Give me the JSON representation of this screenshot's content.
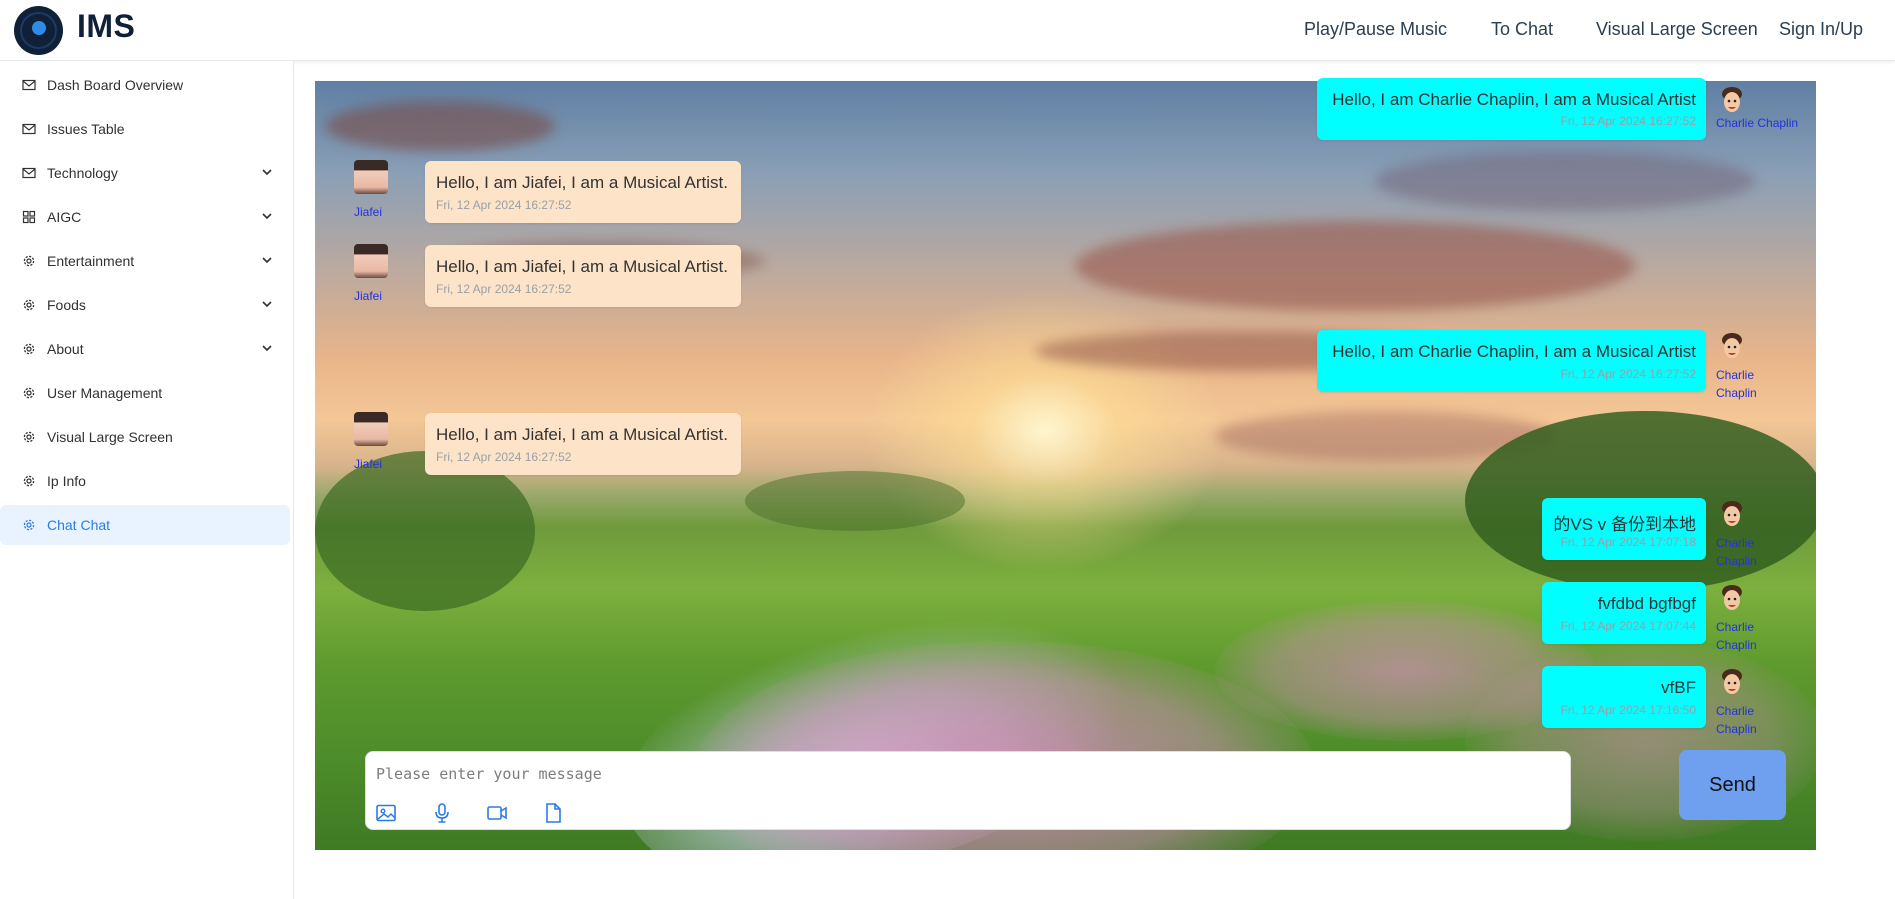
{
  "header": {
    "app_title": "IMS",
    "nav": [
      "Play/Pause Music",
      "To Chat",
      "Visual Large Screen",
      "Sign In/Up"
    ]
  },
  "sidebar": {
    "items": [
      {
        "label": "Dash Board Overview",
        "icon": "mail-icon",
        "expandable": false
      },
      {
        "label": "Issues Table",
        "icon": "mail-icon",
        "expandable": false
      },
      {
        "label": "Technology",
        "icon": "mail-icon",
        "expandable": true
      },
      {
        "label": "AIGC",
        "icon": "grid-icon",
        "expandable": true
      },
      {
        "label": "Entertainment",
        "icon": "gear-icon",
        "expandable": true
      },
      {
        "label": "Foods",
        "icon": "gear-icon",
        "expandable": true
      },
      {
        "label": "About",
        "icon": "gear-icon",
        "expandable": true
      },
      {
        "label": "User Management",
        "icon": "gear-icon",
        "expandable": false
      },
      {
        "label": "Visual Large Screen",
        "icon": "gear-icon",
        "expandable": false
      },
      {
        "label": "Ip Info",
        "icon": "gear-icon",
        "expandable": false
      },
      {
        "label": "Chat Chat",
        "icon": "gear-icon",
        "expandable": false,
        "active": true
      }
    ]
  },
  "chat": {
    "messages": [
      {
        "side": "right",
        "sender": "Charlie Chaplin",
        "text": "Hello, I am Charlie Chaplin, I am a Musical Artist",
        "time": "Fri, 12 Apr 2024 16:27:52"
      },
      {
        "side": "left",
        "sender": "Jiafei",
        "text": "Hello, I am Jiafei, I am a Musical Artist.",
        "time": "Fri, 12 Apr 2024 16:27:52"
      },
      {
        "side": "left",
        "sender": "Jiafei",
        "text": "Hello, I am Jiafei, I am a Musical Artist.",
        "time": "Fri, 12 Apr 2024 16:27:52"
      },
      {
        "side": "right",
        "sender": "Charlie Chaplin",
        "text": "Hello, I am Charlie Chaplin, I am a Musical Artist",
        "time": "Fri, 12 Apr 2024 16:27:52"
      },
      {
        "side": "left",
        "sender": "Jiafei",
        "text": "Hello, I am Jiafei, I am a Musical Artist.",
        "time": "Fri, 12 Apr 2024 16:27:52"
      },
      {
        "side": "right",
        "sender": "Charlie Chaplin",
        "text": "的VS v 备份到本地",
        "time": "Fri, 12 Apr 2024 17:07:18"
      },
      {
        "side": "right",
        "sender": "Charlie Chaplin",
        "text": "fvfdbd bgfbgf",
        "time": "Fri, 12 Apr 2024 17:07:44"
      },
      {
        "side": "right",
        "sender": "Charlie Chaplin",
        "text": "vfBF",
        "time": "Fri, 12 Apr 2024 17:16:50"
      }
    ],
    "input": {
      "placeholder": "Please enter your message",
      "value": ""
    },
    "tools": [
      "image-icon",
      "microphone-icon",
      "video-icon",
      "file-icon"
    ],
    "send_label": "Send"
  },
  "colors": {
    "accent": "#2c7be5",
    "left_bubble": "#fde3c8",
    "right_bubble": "#00ffff",
    "send_button": "#6fa0f0",
    "sender_name": "#2233dd"
  }
}
